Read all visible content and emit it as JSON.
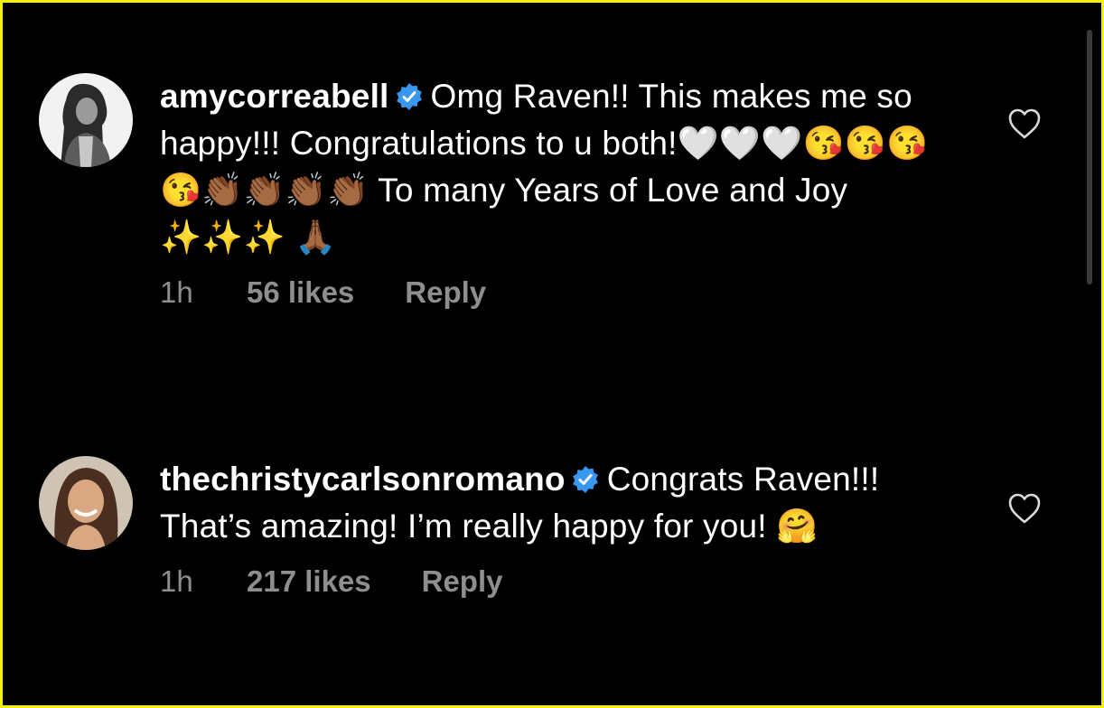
{
  "comments": [
    {
      "username": "amycorreabell",
      "text": "Omg Raven!! This makes me so happy!!! Congratulations to u both!🤍🤍🤍😘😘😘😘👏🏾👏🏾👏🏾👏🏾 To many Years of Love and Joy ✨✨✨ 🙏🏾",
      "time": "1h",
      "likes": "56 likes",
      "reply": "Reply"
    },
    {
      "username": "thechristycarlsonromano",
      "text": "Congrats Raven!!! That’s amazing! I’m really happy for you! 🤗",
      "time": "1h",
      "likes": "217 likes",
      "reply": "Reply"
    }
  ],
  "colors": {
    "background": "#000000",
    "meta_text": "#8e8e8e",
    "verified_badge": "#3897f0",
    "frame": "#f3f300"
  },
  "icons": {
    "verified": "verified-badge-icon",
    "like": "heart-outline-icon"
  }
}
